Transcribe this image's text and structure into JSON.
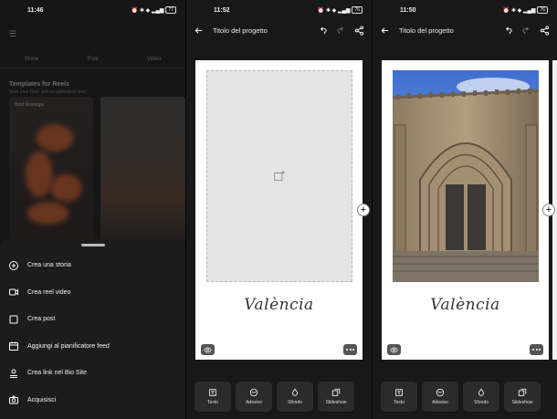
{
  "panel1": {
    "status": {
      "time": "11:46",
      "battery": "77"
    },
    "background": {
      "tabs": [
        "Storie",
        "Post",
        "Video"
      ],
      "templates_title": "Templates for Reels",
      "templates_sub": "Start your Reel with a captivating look",
      "card1_tag": "Bold Nostalgia"
    },
    "sheet": {
      "items": [
        {
          "label": "Crea una storia",
          "icon": "add-circle-icon"
        },
        {
          "label": "Crea reel video",
          "icon": "video-camera-icon"
        },
        {
          "label": "Crea post",
          "icon": "square-icon"
        },
        {
          "label": "Aggiungi al pianificatore feed",
          "icon": "calendar-icon"
        },
        {
          "label": "Crea link nel Bio Site",
          "icon": "person-link-icon"
        },
        {
          "label": "Acquisisci",
          "icon": "camera-icon"
        }
      ]
    }
  },
  "panel2": {
    "status": {
      "time": "11:52",
      "battery": "76"
    },
    "title": "Titolo del progetto",
    "signature": "València",
    "tools": [
      {
        "label": "Testo",
        "icon": "text-box-icon"
      },
      {
        "label": "Adesivo",
        "icon": "sticker-icon"
      },
      {
        "label": "Sfondo",
        "icon": "drop-icon"
      },
      {
        "label": "Slideshow",
        "icon": "slideshow-icon"
      }
    ]
  },
  "panel3": {
    "status": {
      "time": "11:50",
      "battery": "76"
    },
    "title": "Titolo del progetto",
    "signature": "València",
    "tools": [
      {
        "label": "Testo",
        "icon": "text-box-icon"
      },
      {
        "label": "Adesivo",
        "icon": "sticker-icon"
      },
      {
        "label": "Sfondo",
        "icon": "drop-icon"
      },
      {
        "label": "Slideshow",
        "icon": "slideshow-icon"
      }
    ]
  }
}
